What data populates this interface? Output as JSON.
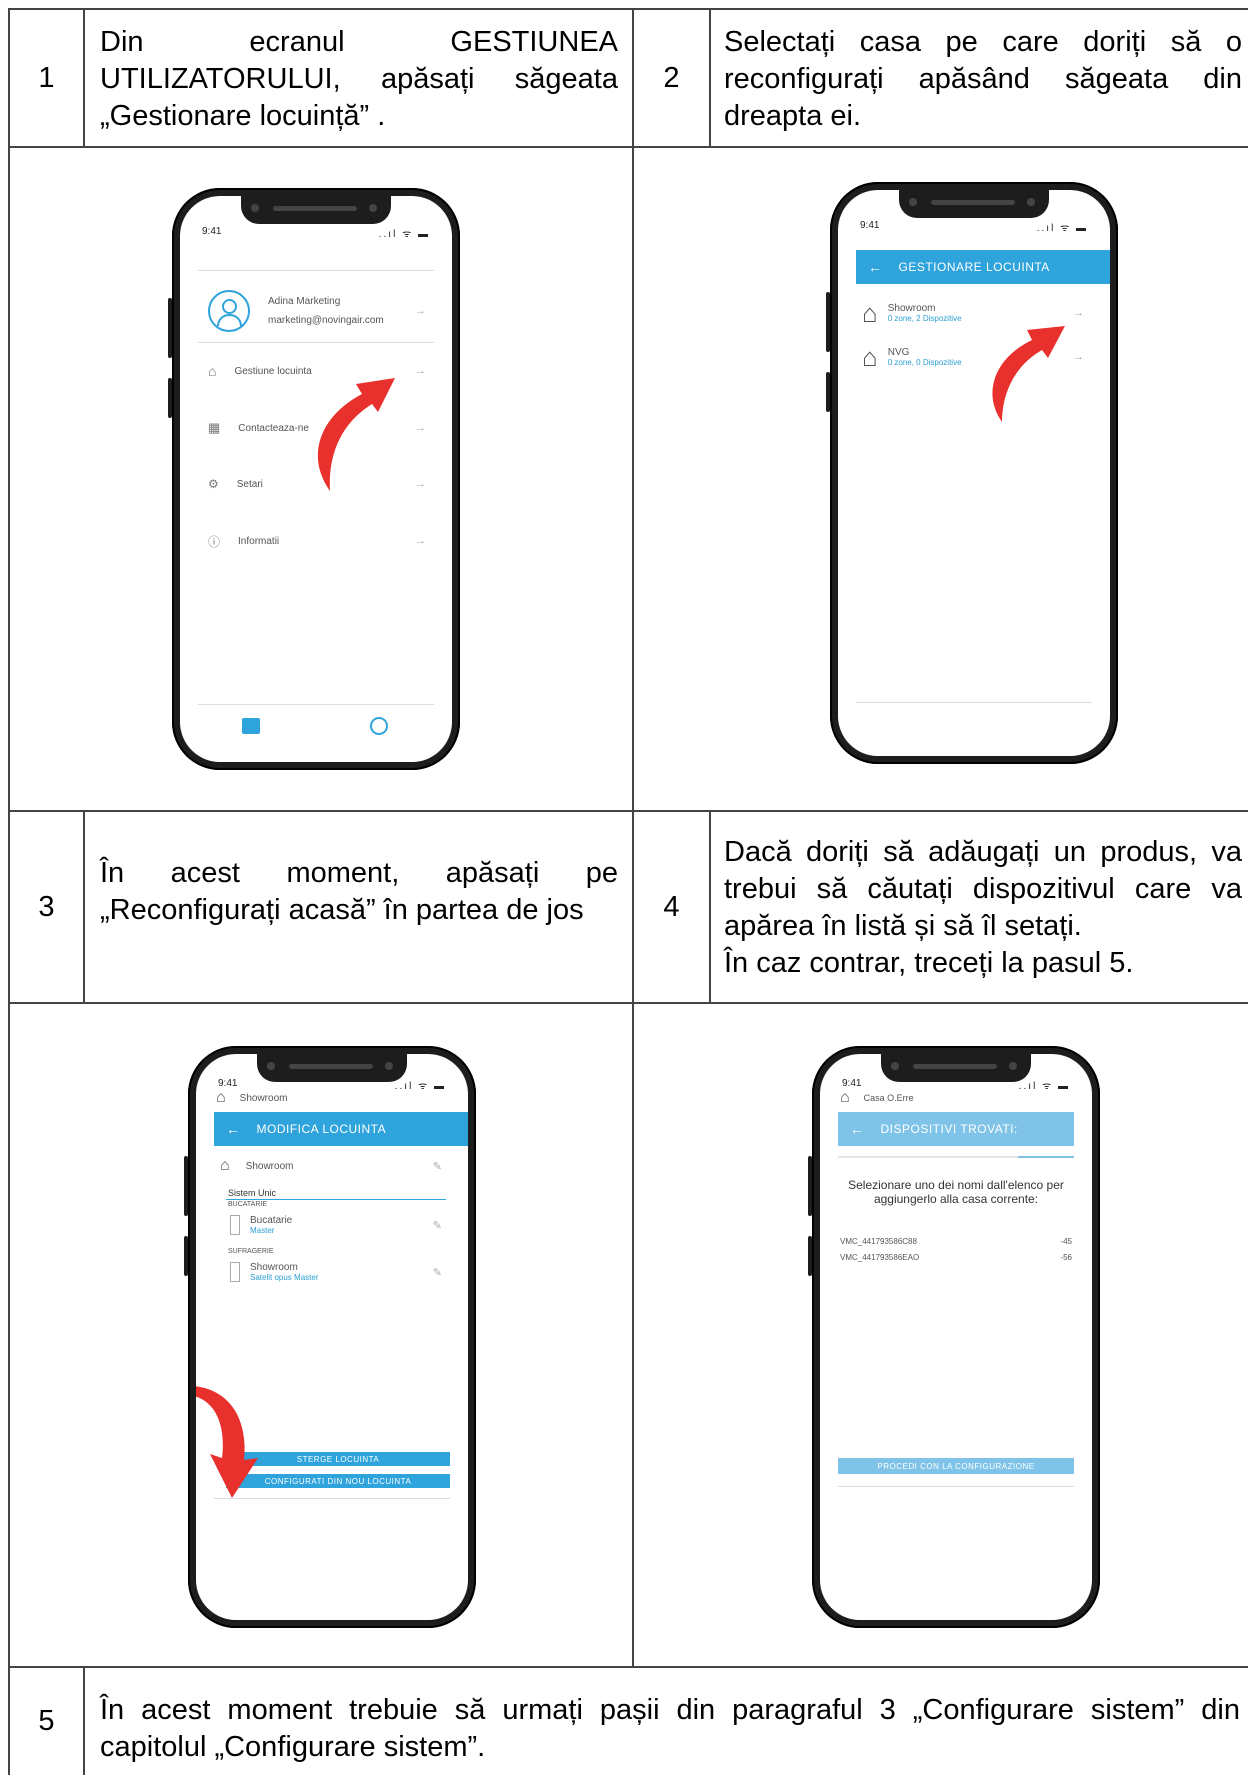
{
  "steps": [
    {
      "num": "1",
      "text": "Din ecranul GESTIUNEA UTILIZATORULUI, apăsați săgeata „Gestionare locuință” ."
    },
    {
      "num": "2",
      "text": "Selectați casa pe care doriți să o reconfigurați apăsând săgeata din dreapta ei."
    },
    {
      "num": "3",
      "text": "În acest moment, apăsați pe „Reconfigurați acasă” în partea de jos"
    },
    {
      "num": "4",
      "lines": [
        "Dacă doriți să adăugați un produs, va trebui să căutați dispozitivul care va apărea în listă și să îl setați.",
        "În caz contrar, treceți la pasul 5."
      ]
    },
    {
      "num": "5",
      "text": "În acest moment trebuie să urmați pașii din paragraful 3 „Configurare sistem” din capitolul „Configurare sistem”."
    }
  ],
  "status": {
    "time": "9:41",
    "icons": "..ıl ᯤ ▬"
  },
  "screen1": {
    "user_name": "Adina Marketing",
    "user_email": "marketing@novingair.com",
    "menu": [
      "Gestiune locuinta",
      "Contacteaza-ne",
      "Setari",
      "Informatii"
    ]
  },
  "screen2": {
    "title": "GESTIONARE LOCUINTA",
    "homes": [
      {
        "name": "Showroom",
        "sub": "0 zone, 2 Dispozitive"
      },
      {
        "name": "NVG",
        "sub": "0 zone, 0 Dispozitive"
      }
    ]
  },
  "screen3": {
    "top_label": "Showroom",
    "title": "MODIFICA LOCUINTA",
    "home_name": "Showroom",
    "system": "Sistem Unic",
    "rooms": [
      {
        "room": "BUCATARIE",
        "device": "Bucatarie",
        "role": "Master"
      },
      {
        "room": "SUFRAGERIE",
        "device": "Showroom",
        "role": "Satelit opus Master"
      }
    ],
    "btn_delete": "STERGE LOCUINTA",
    "btn_reconfig": "CONFIGURATI DIN NOU LOCUINTA"
  },
  "screen4": {
    "top_label": "Casa O.Erre",
    "title": "DISPOSITIVI TROVATI:",
    "instruction": "Selezionare uno dei nomi dall'elenco per aggiungerlo alla casa corrente:",
    "devices": [
      {
        "name": "VMC_441793586C88",
        "rssi": "-45"
      },
      {
        "name": "VMC_441793586EAO",
        "rssi": "-56"
      }
    ],
    "btn": "PROCEDI CON LA CONFIGURAZIONE"
  }
}
